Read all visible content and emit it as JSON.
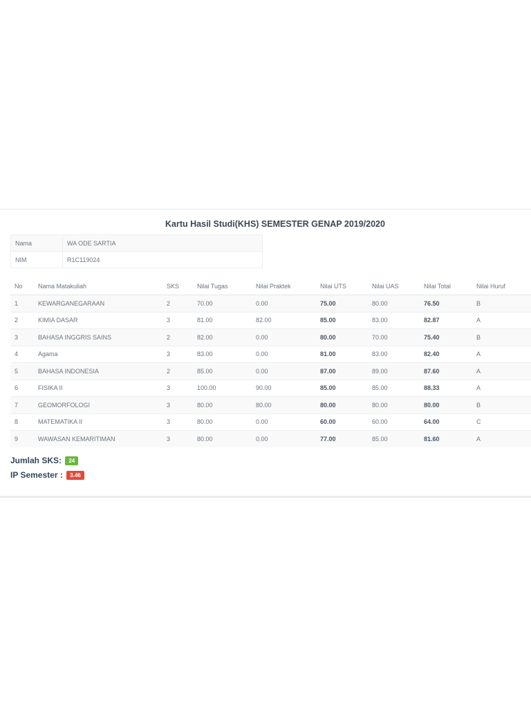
{
  "title": "Kartu Hasil Studi(KHS) SEMESTER GENAP 2019/2020",
  "student": {
    "name_label": "Nama",
    "name_value": "WA ODE SARTIA",
    "nim_label": "NIM",
    "nim_value": "R1C119024"
  },
  "table": {
    "headers": [
      "No",
      "Nama Matakuliah",
      "SKS",
      "Nilai Tugas",
      "Nilai Praktek",
      "Nilai UTS",
      "Nilai UAS",
      "Nilai Total",
      "Nilai Huruf"
    ],
    "rows": [
      [
        "1",
        "KEWARGANEGARAAN",
        "2",
        "70.00",
        "0.00",
        "75.00",
        "80.00",
        "76.50",
        "B"
      ],
      [
        "2",
        "KIMIA DASAR",
        "3",
        "81.00",
        "82.00",
        "85.00",
        "83.00",
        "82.87",
        "A"
      ],
      [
        "3",
        "BAHASA INGGRIS SAINS",
        "2",
        "82.00",
        "0.00",
        "80.00",
        "70.00",
        "75.40",
        "B"
      ],
      [
        "4",
        "Agama",
        "3",
        "83.00",
        "0.00",
        "81.00",
        "83.00",
        "82.40",
        "A"
      ],
      [
        "5",
        "BAHASA INDONESIA",
        "2",
        "85.00",
        "0.00",
        "87.00",
        "89.00",
        "87.60",
        "A"
      ],
      [
        "6",
        "FISIKA II",
        "3",
        "100.00",
        "90.00",
        "85.00",
        "85.00",
        "88.33",
        "A"
      ],
      [
        "7",
        "GEOMORFOLOGI",
        "3",
        "80.00",
        "80.00",
        "80.00",
        "80.00",
        "80.00",
        "B"
      ],
      [
        "8",
        "MATEMATIKA II",
        "3",
        "80.00",
        "0.00",
        "60.00",
        "60.00",
        "64.00",
        "C"
      ],
      [
        "9",
        "WAWASAN KEMARITIMAN",
        "3",
        "80.00",
        "0.00",
        "77.00",
        "85.00",
        "81.60",
        "A"
      ]
    ]
  },
  "summary": {
    "sks_label": "Jumlah SKS:",
    "sks_value": "24",
    "sks_color": "#6cb63f",
    "ip_label": "IP Semester :",
    "ip_value": "3.46",
    "ip_color": "#e04b3c"
  }
}
